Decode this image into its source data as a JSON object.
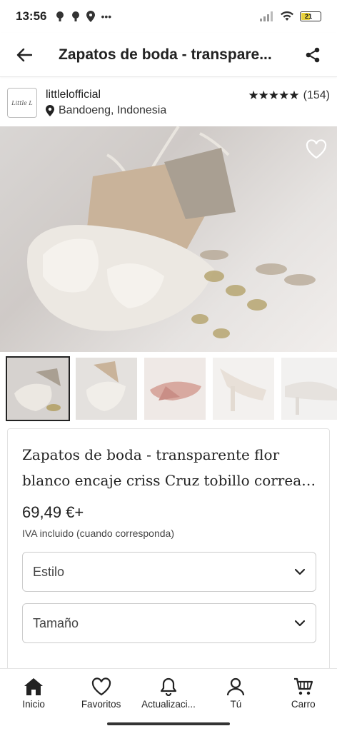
{
  "status": {
    "time": "13:56",
    "more": "•••",
    "battery": "21"
  },
  "header": {
    "title": "Zapatos de boda - transpare..."
  },
  "shop": {
    "logo_text": "Little L",
    "name": "littlelofficial",
    "location": "Bandoeng, Indonesia",
    "stars": "★★★★★",
    "review_count": "(154)"
  },
  "product": {
    "title_line1": "Zapatos de boda - transparente flor",
    "title_line2": "blanco encaje criss Cruz tobillo correa ...",
    "price": "69,49 €+",
    "tax_note": "IVA incluido (cuando corresponda)",
    "options": [
      {
        "label": "Estilo"
      },
      {
        "label": "Tamaño"
      }
    ]
  },
  "nav": [
    {
      "label": "Inicio",
      "icon": "home-icon"
    },
    {
      "label": "Favoritos",
      "icon": "heart-icon"
    },
    {
      "label": "Actualizaci...",
      "icon": "bell-icon"
    },
    {
      "label": "Tú",
      "icon": "user-icon"
    },
    {
      "label": "Carro",
      "icon": "cart-icon"
    }
  ],
  "colors": {
    "accent": "#222222",
    "card_border": "#e2e2e2",
    "battery": "#e8d13a"
  }
}
